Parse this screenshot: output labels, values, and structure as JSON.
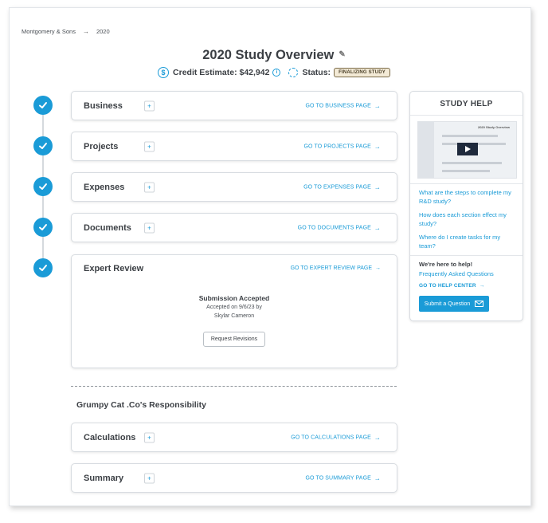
{
  "breadcrumb": {
    "company": "Montgomery & Sons",
    "separator": "→",
    "year": "2020"
  },
  "header": {
    "title": "2020 Study Overview",
    "credit_label": "Credit Estimate:",
    "credit_value": "$42,942",
    "status_label": "Status:",
    "status_badge": "FINALIZING STUDY"
  },
  "sections": [
    {
      "label": "Business",
      "plus": "+",
      "link": "GO TO BUSINESS PAGE",
      "arrow": "→"
    },
    {
      "label": "Projects",
      "plus": "+",
      "link": "GO TO PROJECTS PAGE",
      "arrow": "→"
    },
    {
      "label": "Expenses",
      "plus": "+",
      "link": "GO TO EXPENSES PAGE",
      "arrow": "→"
    },
    {
      "label": "Documents",
      "plus": "+",
      "link": "GO TO DOCUMENTS PAGE",
      "arrow": "→"
    }
  ],
  "expert_review": {
    "label": "Expert Review",
    "link": "GO TO EXPERT REVIEW PAGE",
    "arrow": "→",
    "status_title": "Submission Accepted",
    "accepted_line": "Accepted on 9/6/23 by",
    "reviewer": "Skylar Cameron",
    "button": "Request Revisions"
  },
  "responsibility": {
    "title": "Grumpy Cat .Co's Responsibility",
    "sections": [
      {
        "label": "Calculations",
        "plus": "+",
        "link": "GO TO CALCULATIONS PAGE",
        "arrow": "→"
      },
      {
        "label": "Summary",
        "plus": "+",
        "link": "GO TO SUMMARY PAGE",
        "arrow": "→"
      }
    ]
  },
  "help": {
    "title": "STUDY HELP",
    "video_title": "2020 Study Overview",
    "questions": [
      "What are the steps to complete my R&D study?",
      "How does each section effect my study?",
      "Where do I create tasks for my team?"
    ],
    "here_text": "We're here to help!",
    "faq": "Frequently Asked Questions",
    "help_center": "GO TO HELP CENTER",
    "arrow": "→",
    "submit": "Submit a Question"
  },
  "colors": {
    "accent": "#1a9bd7",
    "badge_bg": "#f3ead6",
    "text": "#3b3f44"
  },
  "icons": [
    "dollar-icon",
    "info-icon",
    "status-spinner-icon",
    "pencil-icon",
    "check-icon",
    "plus-icon",
    "arrow-right-icon",
    "play-icon",
    "mail-icon"
  ]
}
